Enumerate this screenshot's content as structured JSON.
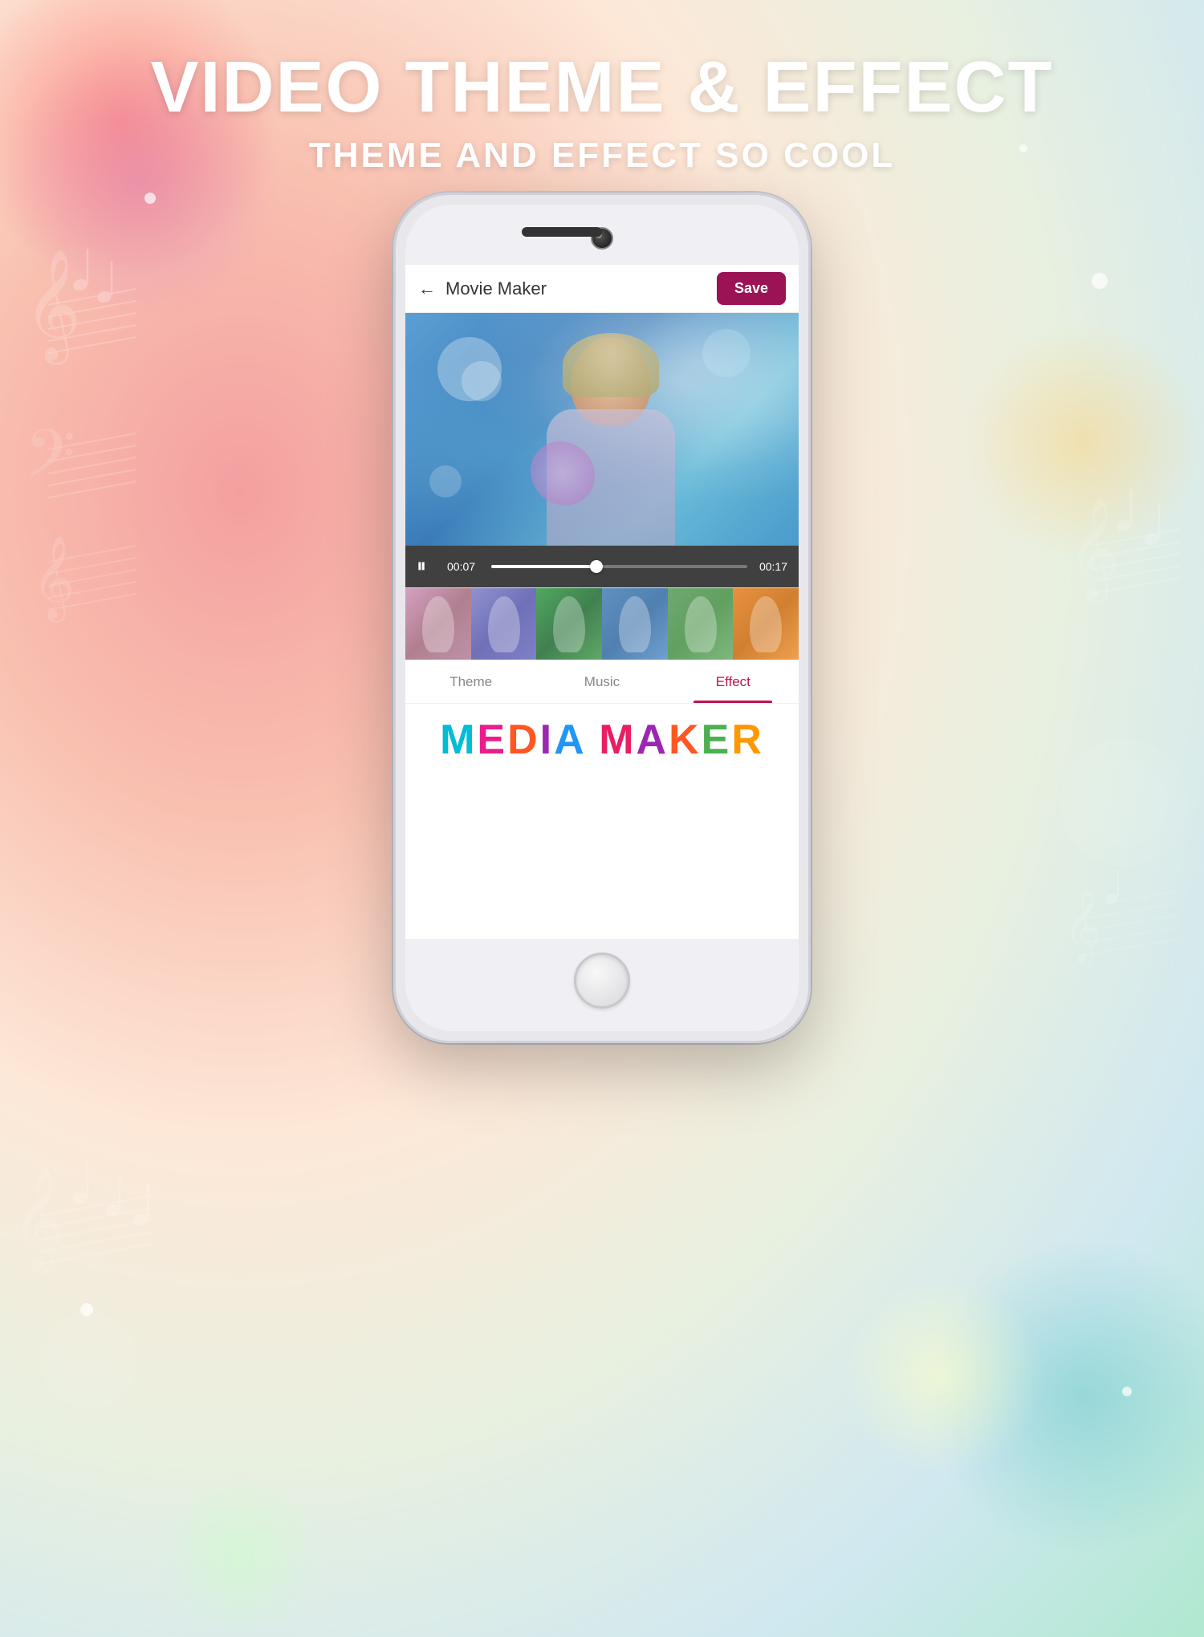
{
  "page": {
    "title_main": "VIDEO THEME & EFFECT",
    "title_sub": "THEME AND EFFECT SO COOL"
  },
  "header": {
    "back_label": "←",
    "title": "Movie Maker",
    "save_label": "Save"
  },
  "video": {
    "time_current": "00:07",
    "time_total": "00:17",
    "progress_percent": 41
  },
  "tabs": [
    {
      "label": "Theme",
      "active": false
    },
    {
      "label": "Music",
      "active": false
    },
    {
      "label": "Effect",
      "active": true
    }
  ],
  "media_maker": {
    "text": "MEDIA MAKER"
  },
  "thumbnails": [
    {
      "id": 1
    },
    {
      "id": 2
    },
    {
      "id": 3
    },
    {
      "id": 4
    },
    {
      "id": 5
    },
    {
      "id": 6
    }
  ]
}
